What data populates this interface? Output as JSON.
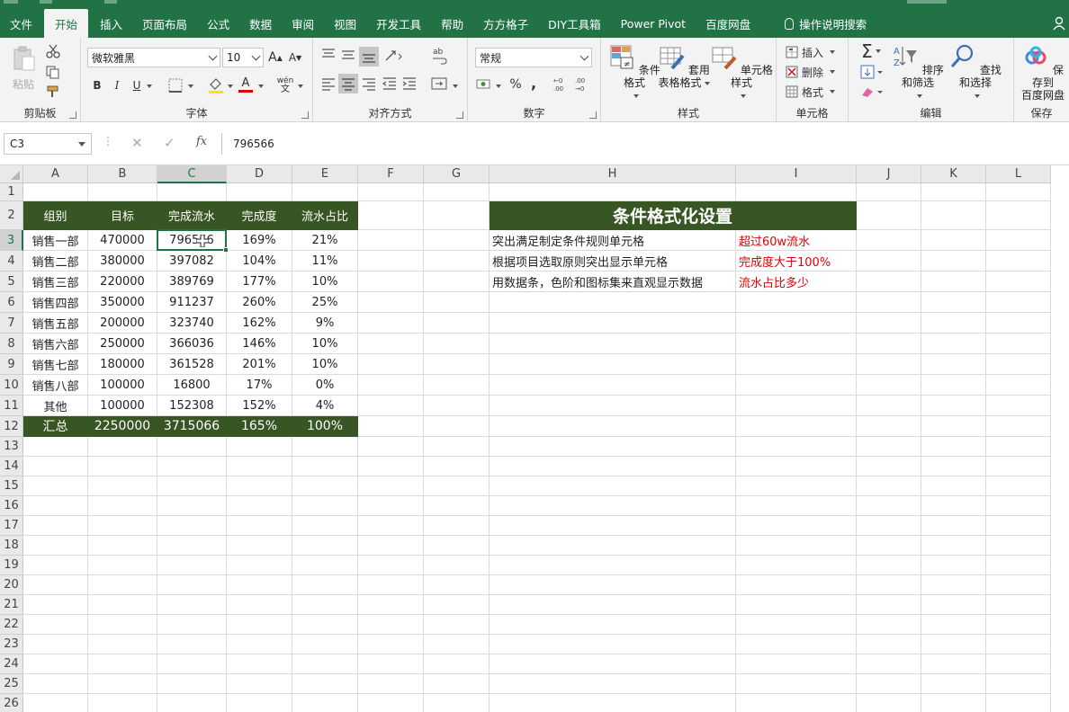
{
  "tabs": [
    "文件",
    "开始",
    "插入",
    "页面布局",
    "公式",
    "数据",
    "审阅",
    "视图",
    "开发工具",
    "帮助",
    "方方格子",
    "DIY工具箱",
    "Power Pivot",
    "百度网盘"
  ],
  "active_tab": "开始",
  "tell_me": "操作说明搜索",
  "ribbon": {
    "clipboard": {
      "label": "剪贴板",
      "paste": "粘贴"
    },
    "font": {
      "label": "字体",
      "font_name": "微软雅黑",
      "font_size": "10",
      "bold": "B",
      "italic": "I",
      "underline": "U",
      "font_color_glyph": "A",
      "wen": "wén",
      "grow": "A",
      "shrink": "A"
    },
    "alignment": {
      "label": "对齐方式"
    },
    "number": {
      "label": "数字",
      "format": "常规",
      "percent": "%",
      "comma": ","
    },
    "styles": {
      "label": "样式",
      "cond_format": "条件格式",
      "table_format_1": "套用",
      "table_format_2": "表格格式",
      "cell_styles": "单元格样式"
    },
    "cells": {
      "label": "单元格",
      "insert": "插入",
      "delete": "删除",
      "format": "格式"
    },
    "editing": {
      "label": "编辑",
      "sort_filter": "排序和筛选",
      "find_select": "查找和选择",
      "sigma": "Σ"
    },
    "save": {
      "label": "保存",
      "save_1": "保存到",
      "save_2": "百度网盘"
    }
  },
  "formula_bar": {
    "name_box": "C3",
    "fx": "fx",
    "value": "796566"
  },
  "columns": [
    "A",
    "B",
    "C",
    "D",
    "E",
    "F",
    "G",
    "H",
    "I",
    "J",
    "K",
    "L"
  ],
  "selected_column": "C",
  "selected_row": 3,
  "rows": [
    "1",
    "2",
    "3",
    "4",
    "5",
    "6",
    "7",
    "8",
    "9",
    "10",
    "11",
    "12",
    "13",
    "14",
    "15",
    "16",
    "17",
    "18",
    "19",
    "20",
    "21",
    "22",
    "23",
    "24",
    "25",
    "26"
  ],
  "table": {
    "headers": [
      "组别",
      "目标",
      "完成流水",
      "完成度",
      "流水占比"
    ],
    "rows": [
      [
        "销售一部",
        "470000",
        "796566",
        "169%",
        "21%"
      ],
      [
        "销售二部",
        "380000",
        "397082",
        "104%",
        "11%"
      ],
      [
        "销售三部",
        "220000",
        "389769",
        "177%",
        "10%"
      ],
      [
        "销售四部",
        "350000",
        "911237",
        "260%",
        "25%"
      ],
      [
        "销售五部",
        "200000",
        "323740",
        "162%",
        "9%"
      ],
      [
        "销售六部",
        "250000",
        "366036",
        "146%",
        "10%"
      ],
      [
        "销售七部",
        "180000",
        "361528",
        "201%",
        "10%"
      ],
      [
        "销售八部",
        "100000",
        "16800",
        "17%",
        "0%"
      ],
      [
        "其他",
        "100000",
        "152308",
        "152%",
        "4%"
      ]
    ],
    "total": [
      "汇总",
      "2250000",
      "3715066",
      "165%",
      "100%"
    ]
  },
  "notes": {
    "title": "条件格式化设置",
    "items": [
      {
        "desc": "突出满足制定条件规则单元格",
        "example": "超过60w流水"
      },
      {
        "desc": "根据项目选取原则突出显示单元格",
        "example": "完成度大于100%"
      },
      {
        "desc": "用数据条，色阶和图标集来直观显示数据",
        "example": "流水占比多少"
      }
    ]
  },
  "colors": {
    "brand_green": "#217346",
    "header_fill": "#375623",
    "note_red": "#e00000"
  }
}
